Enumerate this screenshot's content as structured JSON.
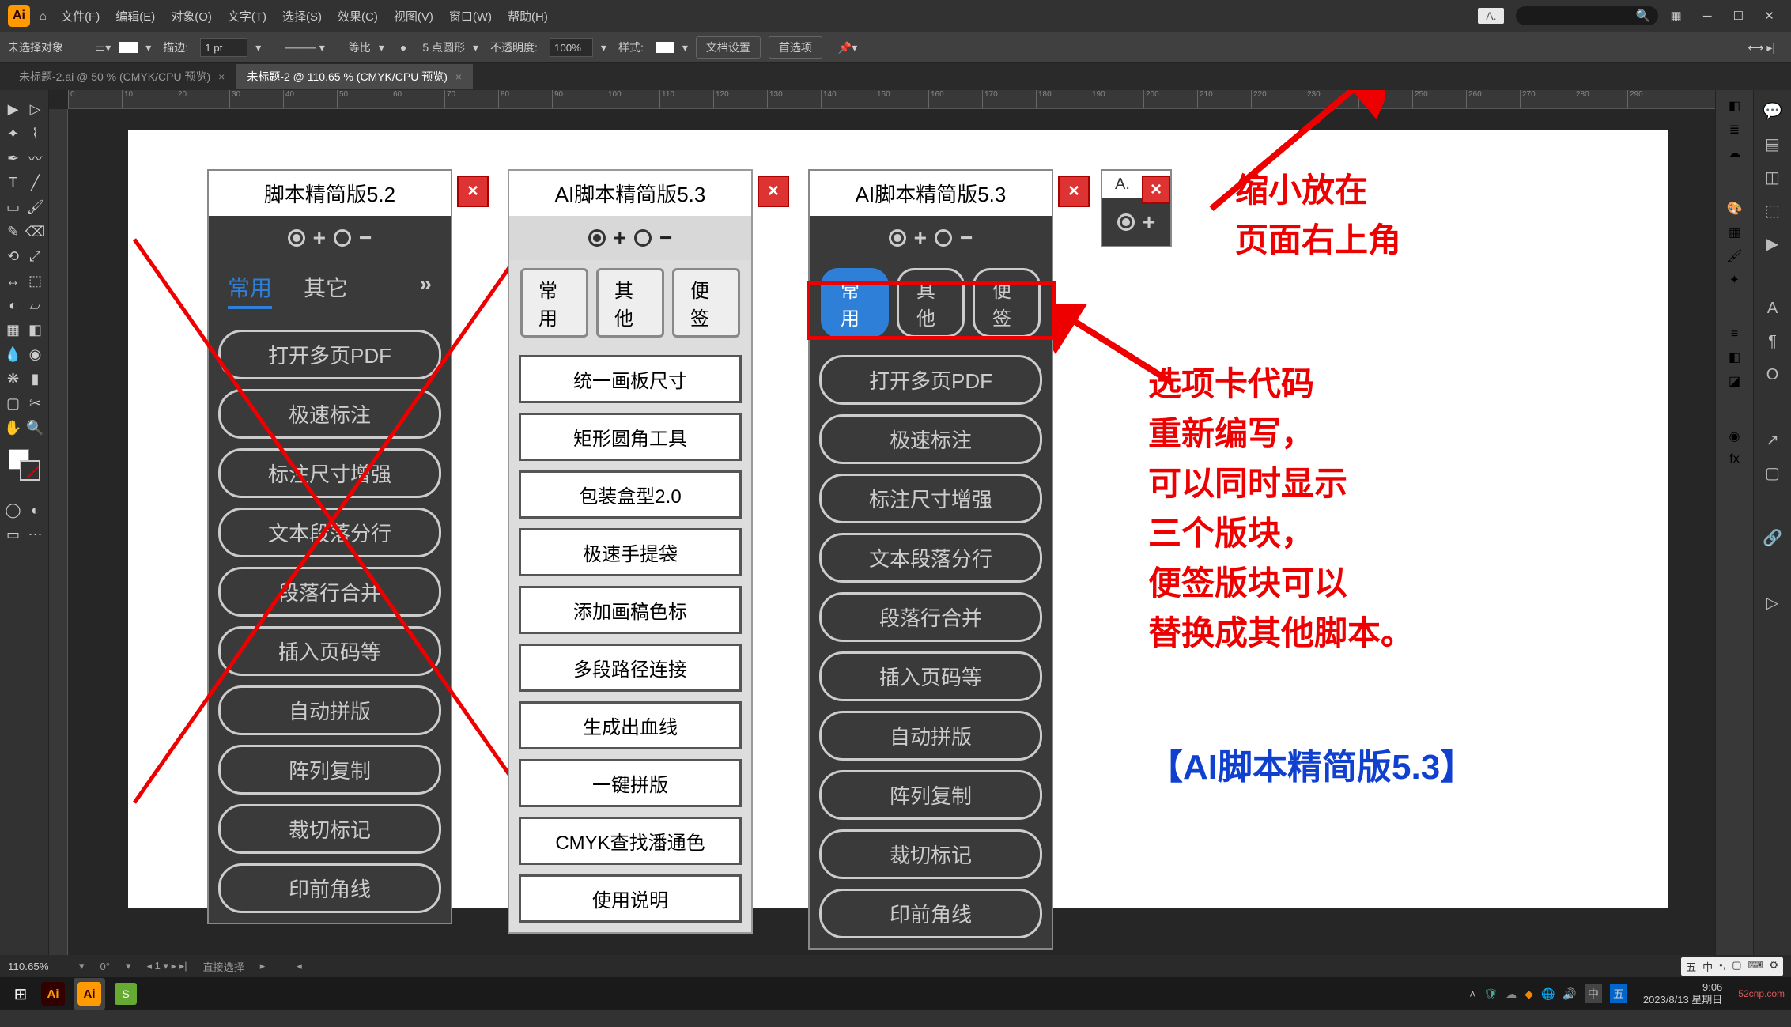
{
  "menu": {
    "items": [
      "文件(F)",
      "编辑(E)",
      "对象(O)",
      "文字(T)",
      "选择(S)",
      "效果(C)",
      "视图(V)",
      "窗口(W)",
      "帮助(H)"
    ],
    "mini_label": "A."
  },
  "options": {
    "no_selection": "未选择对象",
    "stroke_label": "描边:",
    "stroke_val": "1 pt",
    "uniform": "等比",
    "brush_label": "5 点圆形",
    "opacity_label": "不透明度:",
    "opacity_val": "100%",
    "style_label": "样式:",
    "doc_setup": "文档设置",
    "preferences": "首选项"
  },
  "tabs": {
    "t1": "未标题-2.ai @ 50 % (CMYK/CPU 预览)",
    "t2": "未标题-2 @ 110.65 % (CMYK/CPU 预览)"
  },
  "ruler_ticks": [
    0,
    10,
    20,
    30,
    40,
    50,
    60,
    70,
    80,
    90,
    100,
    110,
    120,
    130,
    140,
    150,
    160,
    170,
    180,
    190,
    200,
    210,
    220,
    230,
    240,
    250,
    260,
    270,
    280,
    290
  ],
  "panel52": {
    "title": "脚本精简版5.2",
    "tabs": {
      "t1": "常用",
      "t2": "其它",
      "more": "»"
    },
    "buttons": [
      "打开多页PDF",
      "极速标注",
      "标注尺寸增强",
      "文本段落分行",
      "段落行合并",
      "插入页码等",
      "自动拼版",
      "阵列复制",
      "裁切标记",
      "印前角线"
    ]
  },
  "panel53_light": {
    "title": "AI脚本精简版5.3",
    "tabs": {
      "t1": "常用",
      "t2": "其他",
      "t3": "便签"
    },
    "buttons": [
      "统一画板尺寸",
      "矩形圆角工具",
      "包装盒型2.0",
      "极速手提袋",
      "添加画稿色标",
      "多段路径连接",
      "生成出血线",
      "一键拼版",
      "CMYK查找潘通色",
      "使用说明"
    ]
  },
  "panel53_dark": {
    "title": "AI脚本精简版5.3",
    "tabs": {
      "t1": "常用",
      "t2": "其他",
      "t3": "便签"
    },
    "buttons": [
      "打开多页PDF",
      "极速标注",
      "标注尺寸增强",
      "文本段落分行",
      "段落行合并",
      "插入页码等",
      "自动拼版",
      "阵列复制",
      "裁切标记",
      "印前角线"
    ]
  },
  "mini_panel": {
    "title": "A."
  },
  "annotations": {
    "top": "缩小放在\n页面右上角",
    "mid": "选项卡代码\n重新编写，\n可以同时显示\n三个版块，\n便签版块可以\n替换成其他脚本。",
    "footer": "【AI脚本精简版5.3】"
  },
  "status": {
    "zoom": "110.65%",
    "rotate": "0°",
    "nav": "1",
    "mode": "直接选择"
  },
  "taskbar": {
    "time": "9:06",
    "date": "2023/8/13 星期日",
    "watermark": "52cnp.com"
  }
}
